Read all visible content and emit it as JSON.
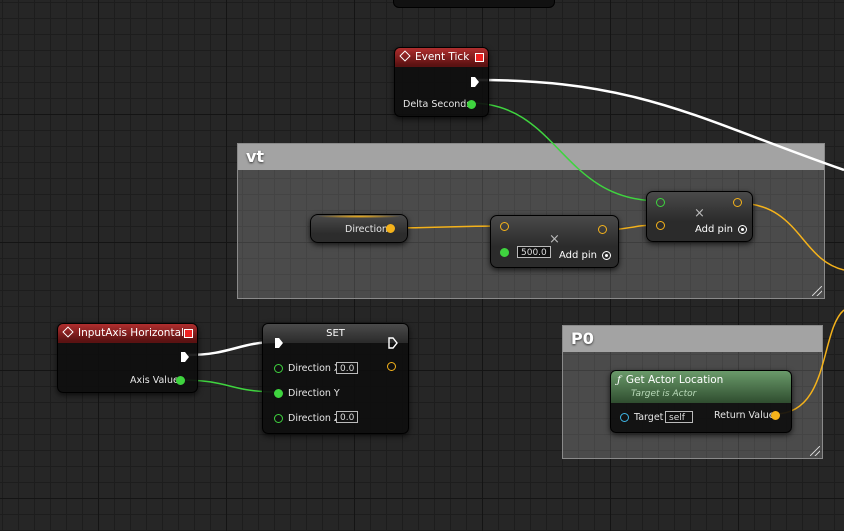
{
  "comments": {
    "vt": "vt",
    "p0": "P0"
  },
  "event_tick": {
    "title": "Event Tick",
    "delta_seconds": "Delta Seconds"
  },
  "direction_var": {
    "label": "Direction"
  },
  "multiply_node": {
    "value": "500.0",
    "add_pin": "Add pin",
    "symbol": "×"
  },
  "multiply_node2": {
    "add_pin": "Add pin",
    "symbol": "×"
  },
  "input_axis": {
    "title": "InputAxis Horizontal",
    "axis_value": "Axis Value"
  },
  "set_node": {
    "title": "SET",
    "direction_x": "Direction X",
    "direction_x_value": "0.0",
    "direction_y": "Direction Y",
    "direction_z": "Direction Z",
    "direction_z_value": "0.0"
  },
  "get_actor_location": {
    "glyph": "ƒ",
    "title": "Get Actor Location",
    "subtitle": "Target is Actor",
    "target": "Target",
    "target_value": "self",
    "return_value": "Return Value"
  },
  "colors": {
    "exec": "#ffffff",
    "float": "#3fd43f",
    "vector": "#f4b21b",
    "object": "#3fb6e6",
    "event_header": "#b02e2e",
    "function_header": "#6a9a6a"
  }
}
